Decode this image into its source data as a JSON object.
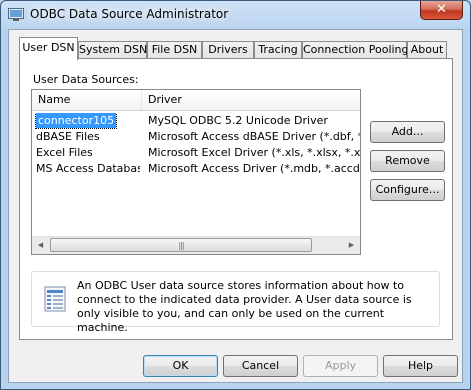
{
  "window": {
    "title": "ODBC Data Source Administrator",
    "close_glyph": "✕"
  },
  "tabs": [
    {
      "label": "User DSN",
      "active": true
    },
    {
      "label": "System DSN",
      "active": false
    },
    {
      "label": "File DSN",
      "active": false
    },
    {
      "label": "Drivers",
      "active": false
    },
    {
      "label": "Tracing",
      "active": false
    },
    {
      "label": "Connection Pooling",
      "active": false
    },
    {
      "label": "About",
      "active": false
    }
  ],
  "panel": {
    "group_label": "User Data Sources:",
    "columns": {
      "name": "Name",
      "driver": "Driver"
    },
    "rows": [
      {
        "name": "connector105",
        "driver": "MySQL ODBC 5.2 Unicode Driver",
        "selected": true
      },
      {
        "name": "dBASE Files",
        "driver": "Microsoft Access dBASE Driver (*.dbf, *.ndx",
        "selected": false
      },
      {
        "name": "Excel Files",
        "driver": "Microsoft Excel Driver (*.xls, *.xlsx, *.xlsm, *.x",
        "selected": false
      },
      {
        "name": "MS Access Database",
        "driver": "Microsoft Access Driver (*.mdb, *.accdb)",
        "selected": false
      }
    ],
    "scrollbar": {
      "left_arrow": "◀",
      "right_arrow": "▶",
      "grip": "|||"
    },
    "buttons": {
      "add": "Add...",
      "remove": "Remove",
      "configure": "Configure..."
    },
    "info_text": "An ODBC User data source stores information about how to connect to the indicated data provider.  A User data source is only visible to you, and can only be used on the current machine."
  },
  "footer": {
    "ok": "OK",
    "cancel": "Cancel",
    "apply": "Apply",
    "help": "Help"
  },
  "colors": {
    "selection": "#3399ff",
    "title_bar": "#b9d3ee",
    "close_button": "#c2361f"
  }
}
